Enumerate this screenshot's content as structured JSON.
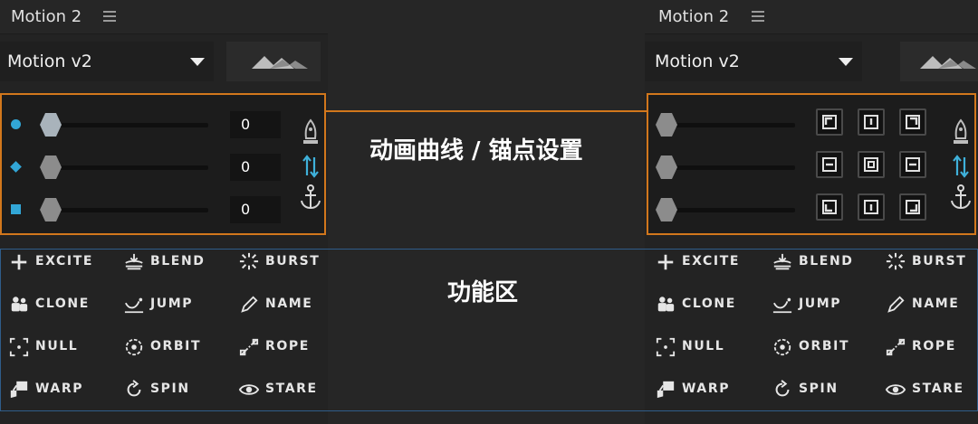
{
  "panels": [
    {
      "title": "Motion 2",
      "preset": "Motion v2",
      "sliders": [
        {
          "marker": "circle",
          "value": "0"
        },
        {
          "marker": "diamond",
          "value": "0"
        },
        {
          "marker": "square",
          "value": "0"
        }
      ],
      "functions": [
        {
          "label": "EXCITE",
          "icon": "plus-icon"
        },
        {
          "label": "BLEND",
          "icon": "blend-icon"
        },
        {
          "label": "BURST",
          "icon": "burst-icon"
        },
        {
          "label": "CLONE",
          "icon": "clone-icon"
        },
        {
          "label": "JUMP",
          "icon": "jump-icon"
        },
        {
          "label": "NAME",
          "icon": "pencil-icon"
        },
        {
          "label": "NULL",
          "icon": "null-icon"
        },
        {
          "label": "ORBIT",
          "icon": "orbit-icon"
        },
        {
          "label": "ROPE",
          "icon": "rope-icon"
        },
        {
          "label": "WARP",
          "icon": "warp-icon"
        },
        {
          "label": "SPIN",
          "icon": "spin-icon"
        },
        {
          "label": "STARE",
          "icon": "eye-icon"
        }
      ]
    },
    {
      "title": "Motion 2",
      "preset": "Motion v2",
      "functions": [
        {
          "label": "EXCITE",
          "icon": "plus-icon"
        },
        {
          "label": "BLEND",
          "icon": "blend-icon"
        },
        {
          "label": "BURST",
          "icon": "burst-icon"
        },
        {
          "label": "CLONE",
          "icon": "clone-icon"
        },
        {
          "label": "JUMP",
          "icon": "jump-icon"
        },
        {
          "label": "NAME",
          "icon": "pencil-icon"
        },
        {
          "label": "NULL",
          "icon": "null-icon"
        },
        {
          "label": "ORBIT",
          "icon": "orbit-icon"
        },
        {
          "label": "ROPE",
          "icon": "rope-icon"
        },
        {
          "label": "WARP",
          "icon": "warp-icon"
        },
        {
          "label": "SPIN",
          "icon": "spin-icon"
        },
        {
          "label": "STARE",
          "icon": "eye-icon"
        }
      ]
    }
  ],
  "annotations": {
    "curve_label": "动画曲线 / 锚点设置",
    "function_label": "功能区"
  },
  "colors": {
    "highlight_border": "#d2771c",
    "function_border": "#2f5d8a",
    "marker": "#32a6d6"
  }
}
